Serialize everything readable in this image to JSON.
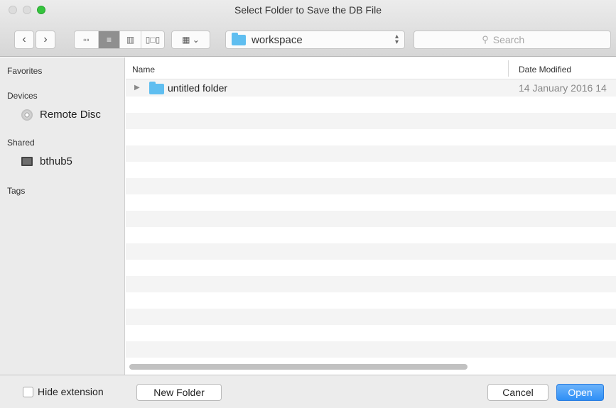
{
  "window": {
    "title": "Select Folder to Save the DB File"
  },
  "toolbar": {
    "back_icon": "chevron-left",
    "forward_icon": "chevron-right",
    "view_modes": [
      "icon-view",
      "list-view",
      "column-view",
      "coverflow-view"
    ],
    "active_view": "list-view",
    "arrange_icon": "grid-arrange",
    "path_popup": "workspace",
    "search_placeholder": "Search"
  },
  "sidebar": {
    "favorites_heading": "Favorites",
    "devices_heading": "Devices",
    "devices": [
      {
        "label": "Remote Disc",
        "icon": "disc-icon"
      }
    ],
    "shared_heading": "Shared",
    "shared": [
      {
        "label": "bthub5",
        "icon": "computer-icon"
      }
    ],
    "tags_heading": "Tags"
  },
  "list": {
    "columns": [
      "Name",
      "Date Modified"
    ],
    "rows": [
      {
        "name": "untitled folder",
        "date_modified": "14 January 2016 14"
      }
    ]
  },
  "bottom": {
    "hide_extension_label": "Hide extension",
    "hide_extension_checked": false,
    "new_folder_label": "New Folder",
    "cancel_label": "Cancel",
    "open_label": "Open"
  },
  "colors": {
    "accent": "#2e8ff6",
    "folder": "#5fbef0",
    "close_dot": "#35c43d"
  }
}
